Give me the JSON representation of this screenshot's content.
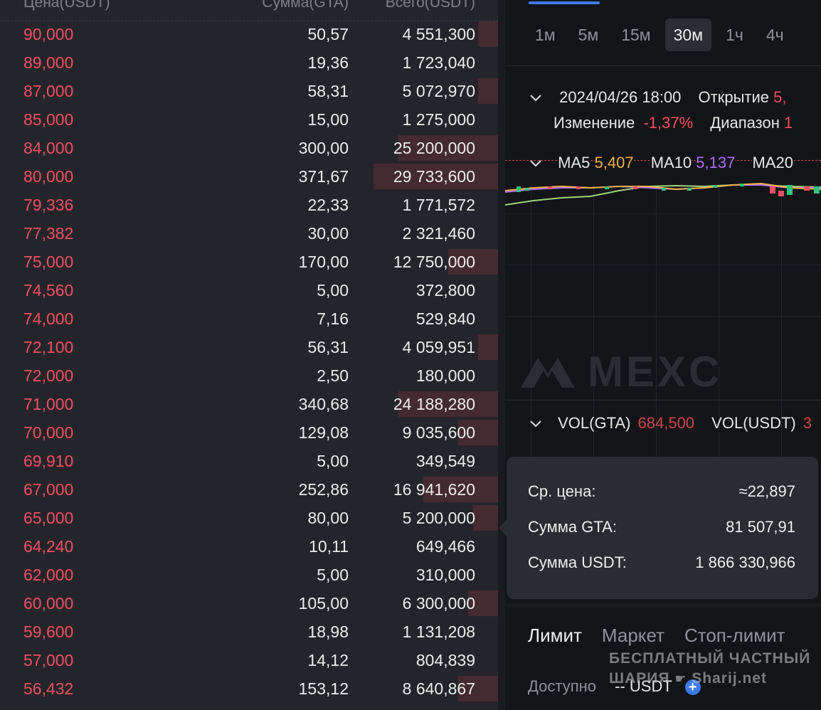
{
  "orderbook": {
    "headers": {
      "price": "Цена(USDT)",
      "amount": "Сумма(GTA)",
      "total": "Всего(USDT)"
    },
    "asks": [
      {
        "price": "90,000",
        "amount": "50,57",
        "total": "4 551,300",
        "depth": 0.04
      },
      {
        "price": "89,000",
        "amount": "19,36",
        "total": "1 723,040",
        "depth": 0.0
      },
      {
        "price": "87,000",
        "amount": "58,31",
        "total": "5 072,970",
        "depth": 0.04
      },
      {
        "price": "85,000",
        "amount": "15,00",
        "total": "1 275,000",
        "depth": 0.0
      },
      {
        "price": "84,000",
        "amount": "300,00",
        "total": "25 200,000",
        "depth": 0.2
      },
      {
        "price": "80,000",
        "amount": "371,67",
        "total": "29 733,600",
        "depth": 0.25
      },
      {
        "price": "79,336",
        "amount": "22,33",
        "total": "1 771,572",
        "depth": 0.0
      },
      {
        "price": "77,382",
        "amount": "30,00",
        "total": "2 321,460",
        "depth": 0.0
      },
      {
        "price": "75,000",
        "amount": "170,00",
        "total": "12 750,000",
        "depth": 0.1
      },
      {
        "price": "74,560",
        "amount": "5,00",
        "total": "372,800",
        "depth": 0.0
      },
      {
        "price": "74,000",
        "amount": "7,16",
        "total": "529,840",
        "depth": 0.0
      },
      {
        "price": "72,100",
        "amount": "56,31",
        "total": "4 059,951",
        "depth": 0.04
      },
      {
        "price": "72,000",
        "amount": "2,50",
        "total": "180,000",
        "depth": 0.0
      },
      {
        "price": "71,000",
        "amount": "340,68",
        "total": "24 188,280",
        "depth": 0.2
      },
      {
        "price": "70,000",
        "amount": "129,08",
        "total": "9 035,600",
        "depth": 0.08
      },
      {
        "price": "69,910",
        "amount": "5,00",
        "total": "349,549",
        "depth": 0.0
      },
      {
        "price": "67,000",
        "amount": "252,86",
        "total": "16 941,620",
        "depth": 0.15
      },
      {
        "price": "65,000",
        "amount": "80,00",
        "total": "5 200,000",
        "depth": 0.05
      },
      {
        "price": "64,240",
        "amount": "10,11",
        "total": "649,466",
        "depth": 0.0
      },
      {
        "price": "62,000",
        "amount": "5,00",
        "total": "310,000",
        "depth": 0.0
      },
      {
        "price": "60,000",
        "amount": "105,00",
        "total": "6 300,000",
        "depth": 0.06
      },
      {
        "price": "59,600",
        "amount": "18,98",
        "total": "1 131,208",
        "depth": 0.0
      },
      {
        "price": "57,000",
        "amount": "14,12",
        "total": "804,839",
        "depth": 0.0
      },
      {
        "price": "56,432",
        "amount": "153,12",
        "total": "8 640,867",
        "depth": 0.08
      }
    ]
  },
  "chart": {
    "timeframes": [
      "1м",
      "5м",
      "15м",
      "30м",
      "1ч",
      "4ч"
    ],
    "active_timeframe": "30м",
    "candle_info": {
      "datetime": "2024/04/26 18:00",
      "open_label": "Открытие",
      "open_value": "5,",
      "change_label": "Изменение",
      "change_value": "-1,37%",
      "range_label": "Диапазон",
      "range_value": "1"
    },
    "ma": {
      "ma5_label": "MA5",
      "ma5_value": "5,407",
      "ma10_label": "MA10",
      "ma10_value": "5,137",
      "ma20_label": "MA20"
    },
    "watermark": "MEXC",
    "volume": {
      "vol_gta_label": "VOL(GTA)",
      "vol_gta_value": "684,500",
      "vol_usdt_label": "VOL(USDT)",
      "vol_usdt_value": "3"
    }
  },
  "tooltip": {
    "avg_price_label": "Ср. цена:",
    "avg_price_value": "≈22,897",
    "sum_gta_label": "Сумма GTA:",
    "sum_gta_value": "81 507,91",
    "sum_usdt_label": "Сумма USDT:",
    "sum_usdt_value": "1 866 330,966"
  },
  "order_form": {
    "tabs": [
      "Лимит",
      "Маркет",
      "Стоп-лимит"
    ],
    "active_tab": "Лимит",
    "available_label": "Доступно",
    "available_value": "-- USDT"
  },
  "site_watermark": {
    "line1": "БЕСПЛАТНЫЙ ЧАСТНЫЙ",
    "line2": "ШАРИЯ",
    "line3": "Sharij.net"
  },
  "colors": {
    "ask_red": "#ef4f63",
    "accent_blue": "#3d7bf5",
    "ma5": "#f2b14a",
    "ma10": "#b06cf0"
  }
}
